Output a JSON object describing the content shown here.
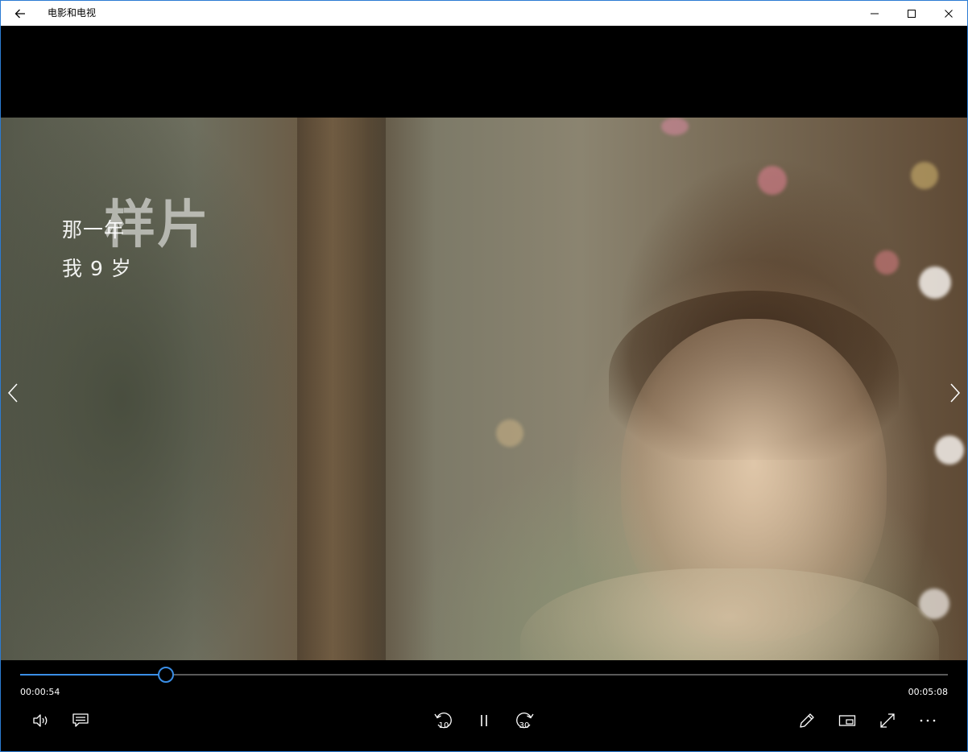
{
  "window": {
    "title": "电影和电视"
  },
  "video": {
    "watermark": "样片",
    "subtitle_line1": "那一年",
    "subtitle_line2": "我 9 岁"
  },
  "playback": {
    "current_time": "00:00:54",
    "duration": "00:05:08",
    "progress_fraction": 0.156,
    "skip_back_seconds": "10",
    "skip_forward_seconds": "30"
  },
  "icons": {
    "back": "back-arrow-icon",
    "minimize": "minimize-icon",
    "maximize": "maximize-icon",
    "close": "close-icon",
    "previous": "chevron-left-icon",
    "next": "chevron-right-icon",
    "volume": "volume-icon",
    "captions": "captions-icon",
    "skip_back": "skip-back-10-icon",
    "pause": "pause-icon",
    "skip_forward": "skip-forward-30-icon",
    "edit": "pencil-icon",
    "mini_view": "mini-view-icon",
    "fullscreen": "fullscreen-icon",
    "more": "more-icon"
  },
  "colors": {
    "accent": "#3a8ee6",
    "window_border": "#2b7bd3",
    "titlebar_bg": "#ffffff",
    "controls_bg": "#000000"
  }
}
